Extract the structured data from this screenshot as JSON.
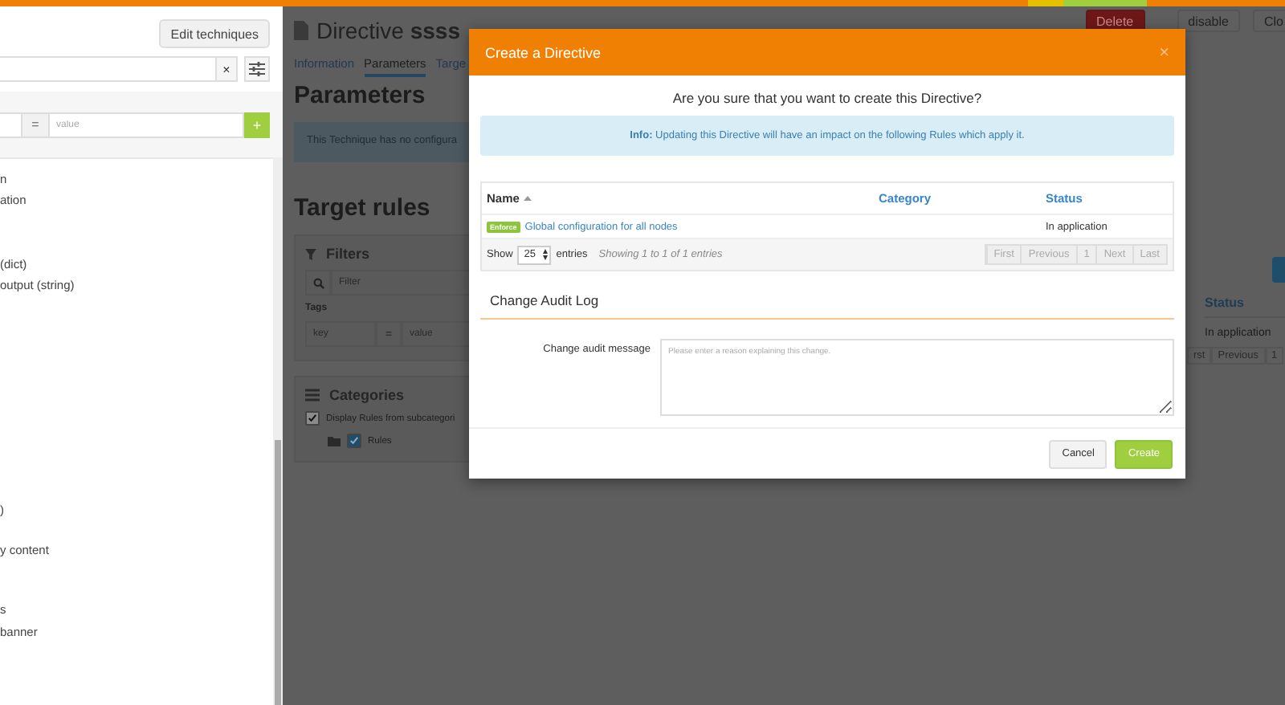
{
  "sidebar": {
    "edit_button": "Edit techniques",
    "clear_label": "×",
    "tag_filter": {
      "separator": "=",
      "value_placeholder": "value",
      "add_label": "+"
    },
    "items": [
      "n",
      "ation",
      "(dict)",
      "output (string)",
      ")",
      "y content",
      "s",
      "banner"
    ]
  },
  "page": {
    "title_prefix": "Directive",
    "title_name": "ssss",
    "actions": [
      {
        "label": "Delete",
        "kind": "danger"
      },
      {
        "label": "disable",
        "kind": "default"
      },
      {
        "label": "Clo",
        "kind": "default"
      }
    ],
    "tabs": [
      {
        "label": "Information",
        "selected": false
      },
      {
        "label": "Parameters",
        "selected": true
      },
      {
        "label": "Targe",
        "selected": false
      }
    ],
    "parameters_heading": "Parameters",
    "parameters_note": "This Technique has no configura",
    "target_heading": "Target rules",
    "filters": {
      "title": "Filters",
      "filter_placeholder": "Filter",
      "tags_label": "Tags",
      "key_placeholder": "key",
      "separator": "=",
      "value_placeholder": "value"
    },
    "categories": {
      "title": "Categories",
      "subcategories": {
        "label": "Display Rules from subcategori",
        "checked": true
      },
      "tree": [
        {
          "label": "Rules",
          "checked": true
        }
      ]
    },
    "rules_table": {
      "status_heading": "Status",
      "status": "In application",
      "pagination": [
        "rst",
        "Previous",
        "1"
      ]
    }
  },
  "dialog": {
    "title": "Create a Directive",
    "close": "×",
    "question": "Are you sure that you want to create this Directive?",
    "info": "**Info:** Updating this Directive will have an impact on the following Rules which apply it.",
    "table": {
      "columns": [
        {
          "label": "Name",
          "sorted": true
        },
        {
          "label": "Category",
          "sorted": false
        },
        {
          "label": "Status",
          "sorted": false
        }
      ],
      "rows": [
        {
          "badge": "Enforce",
          "name": "Global configuration for all nodes",
          "status": "In application"
        }
      ],
      "show_label": "Show",
      "page_size": "25",
      "entries_label": "entries",
      "summary": "Showing 1 to 1 of 1 entries",
      "pagination": [
        {
          "label": "First"
        },
        {
          "label": "Previous"
        },
        {
          "label": "1"
        },
        {
          "label": "Next"
        },
        {
          "label": "Last"
        }
      ]
    },
    "audit_heading": "Change Audit Log",
    "audit_label": "Change audit message",
    "audit_placeholder": "Please enter a reason explaining this change.",
    "buttons": [
      {
        "label": "Cancel",
        "kind": "default"
      },
      {
        "label": "Create",
        "kind": "primary"
      }
    ]
  }
}
